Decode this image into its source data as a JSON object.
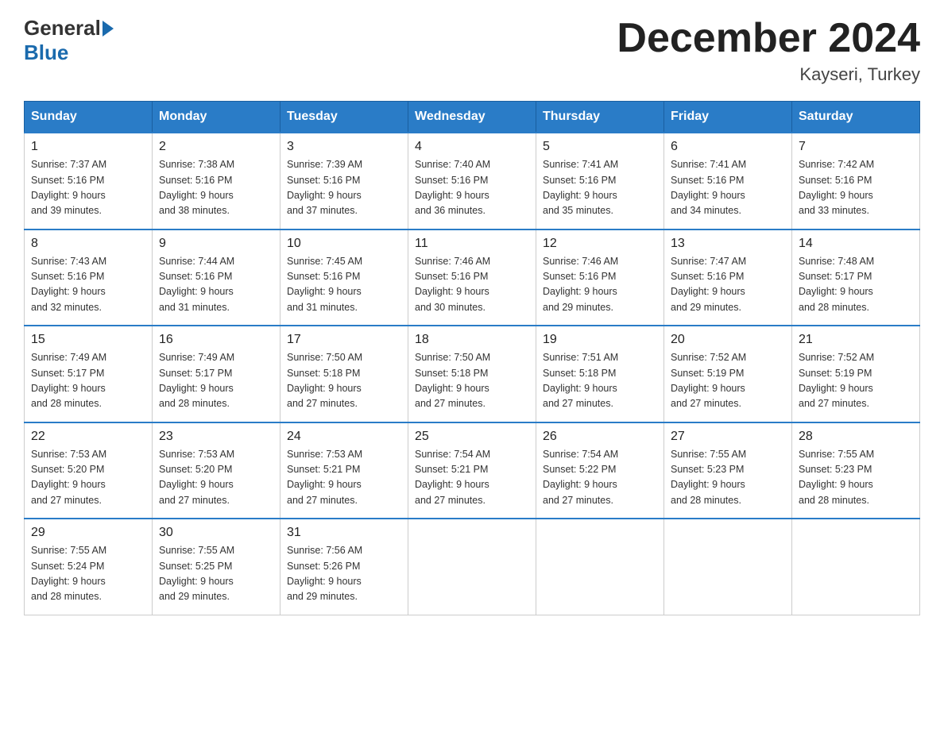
{
  "logo": {
    "text_general": "General",
    "text_blue": "Blue"
  },
  "title": {
    "month_year": "December 2024",
    "location": "Kayseri, Turkey"
  },
  "weekdays": [
    "Sunday",
    "Monday",
    "Tuesday",
    "Wednesday",
    "Thursday",
    "Friday",
    "Saturday"
  ],
  "days": [
    {
      "date": "1",
      "sunrise": "7:37 AM",
      "sunset": "5:16 PM",
      "daylight": "9 hours and 39 minutes."
    },
    {
      "date": "2",
      "sunrise": "7:38 AM",
      "sunset": "5:16 PM",
      "daylight": "9 hours and 38 minutes."
    },
    {
      "date": "3",
      "sunrise": "7:39 AM",
      "sunset": "5:16 PM",
      "daylight": "9 hours and 37 minutes."
    },
    {
      "date": "4",
      "sunrise": "7:40 AM",
      "sunset": "5:16 PM",
      "daylight": "9 hours and 36 minutes."
    },
    {
      "date": "5",
      "sunrise": "7:41 AM",
      "sunset": "5:16 PM",
      "daylight": "9 hours and 35 minutes."
    },
    {
      "date": "6",
      "sunrise": "7:41 AM",
      "sunset": "5:16 PM",
      "daylight": "9 hours and 34 minutes."
    },
    {
      "date": "7",
      "sunrise": "7:42 AM",
      "sunset": "5:16 PM",
      "daylight": "9 hours and 33 minutes."
    },
    {
      "date": "8",
      "sunrise": "7:43 AM",
      "sunset": "5:16 PM",
      "daylight": "9 hours and 32 minutes."
    },
    {
      "date": "9",
      "sunrise": "7:44 AM",
      "sunset": "5:16 PM",
      "daylight": "9 hours and 31 minutes."
    },
    {
      "date": "10",
      "sunrise": "7:45 AM",
      "sunset": "5:16 PM",
      "daylight": "9 hours and 31 minutes."
    },
    {
      "date": "11",
      "sunrise": "7:46 AM",
      "sunset": "5:16 PM",
      "daylight": "9 hours and 30 minutes."
    },
    {
      "date": "12",
      "sunrise": "7:46 AM",
      "sunset": "5:16 PM",
      "daylight": "9 hours and 29 minutes."
    },
    {
      "date": "13",
      "sunrise": "7:47 AM",
      "sunset": "5:16 PM",
      "daylight": "9 hours and 29 minutes."
    },
    {
      "date": "14",
      "sunrise": "7:48 AM",
      "sunset": "5:17 PM",
      "daylight": "9 hours and 28 minutes."
    },
    {
      "date": "15",
      "sunrise": "7:49 AM",
      "sunset": "5:17 PM",
      "daylight": "9 hours and 28 minutes."
    },
    {
      "date": "16",
      "sunrise": "7:49 AM",
      "sunset": "5:17 PM",
      "daylight": "9 hours and 28 minutes."
    },
    {
      "date": "17",
      "sunrise": "7:50 AM",
      "sunset": "5:18 PM",
      "daylight": "9 hours and 27 minutes."
    },
    {
      "date": "18",
      "sunrise": "7:50 AM",
      "sunset": "5:18 PM",
      "daylight": "9 hours and 27 minutes."
    },
    {
      "date": "19",
      "sunrise": "7:51 AM",
      "sunset": "5:18 PM",
      "daylight": "9 hours and 27 minutes."
    },
    {
      "date": "20",
      "sunrise": "7:52 AM",
      "sunset": "5:19 PM",
      "daylight": "9 hours and 27 minutes."
    },
    {
      "date": "21",
      "sunrise": "7:52 AM",
      "sunset": "5:19 PM",
      "daylight": "9 hours and 27 minutes."
    },
    {
      "date": "22",
      "sunrise": "7:53 AM",
      "sunset": "5:20 PM",
      "daylight": "9 hours and 27 minutes."
    },
    {
      "date": "23",
      "sunrise": "7:53 AM",
      "sunset": "5:20 PM",
      "daylight": "9 hours and 27 minutes."
    },
    {
      "date": "24",
      "sunrise": "7:53 AM",
      "sunset": "5:21 PM",
      "daylight": "9 hours and 27 minutes."
    },
    {
      "date": "25",
      "sunrise": "7:54 AM",
      "sunset": "5:21 PM",
      "daylight": "9 hours and 27 minutes."
    },
    {
      "date": "26",
      "sunrise": "7:54 AM",
      "sunset": "5:22 PM",
      "daylight": "9 hours and 27 minutes."
    },
    {
      "date": "27",
      "sunrise": "7:55 AM",
      "sunset": "5:23 PM",
      "daylight": "9 hours and 28 minutes."
    },
    {
      "date": "28",
      "sunrise": "7:55 AM",
      "sunset": "5:23 PM",
      "daylight": "9 hours and 28 minutes."
    },
    {
      "date": "29",
      "sunrise": "7:55 AM",
      "sunset": "5:24 PM",
      "daylight": "9 hours and 28 minutes."
    },
    {
      "date": "30",
      "sunrise": "7:55 AM",
      "sunset": "5:25 PM",
      "daylight": "9 hours and 29 minutes."
    },
    {
      "date": "31",
      "sunrise": "7:56 AM",
      "sunset": "5:26 PM",
      "daylight": "9 hours and 29 minutes."
    }
  ]
}
